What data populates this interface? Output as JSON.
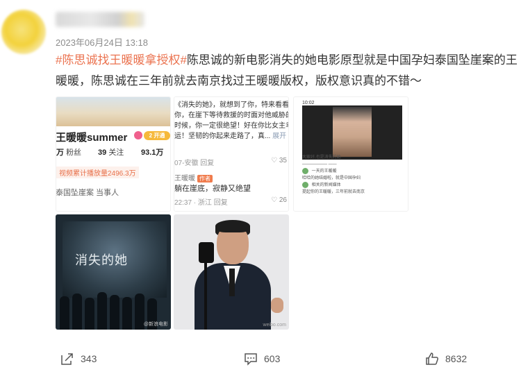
{
  "post": {
    "time": "2023年06月24日 13:18",
    "hashtag": "#陈思诚找王暖暖拿授权#",
    "body": "陈思诚的新电影消失的她电影原型就是中国孕妇泰国坠崖案的王暖暖，陈思诚在三年前就去南京找过王暖暖版权，版权意识真的不错～"
  },
  "images": {
    "tile1": {
      "name": "王暖暖summer",
      "badge": "2 开通",
      "stats": [
        {
          "value": "万",
          "label": "粉丝"
        },
        {
          "value": "39",
          "label": "关注"
        },
        {
          "value": "93.1万",
          "label": ""
        }
      ],
      "views": "视频累计播放量2496.3万",
      "tags": "泰国坠崖案  当事人"
    },
    "tile2": {
      "comment1": "《消失的她》，就想到了你，特来看看你，在崖下等待救援的时面对他威胁的时候，你一定很绝望！好在你比女主幸运！坚韧的你起来走路了，真...",
      "more": "展开",
      "meta1": "07-安徽    回复",
      "likes1": "35",
      "author": "王暖暖",
      "author_tag": "作者",
      "reply": "躺在崖底，寂静又绝望",
      "meta2": "22:37 · 浙江    回复",
      "likes2": "26"
    },
    "tile3": {
      "status_time": "10:02",
      "lines": [
        "大家好,也是消失的她",
        "——————  ——",
        "  一天的王暖暖",
        "  哈哈的她结婚啦，就是中国孕妇",
        "  相关的新闻媒体",
        "  提起你的王暖暖，三年前就去南京"
      ]
    },
    "tile4": {
      "title": "消失的她",
      "watermark": "@新浪电影"
    },
    "tile5": {
      "watermark": "weibo.com"
    }
  },
  "actions": {
    "share_count": "343",
    "comment_count": "603",
    "like_count": "8632"
  },
  "colors": {
    "hashtag": "#eb7350",
    "text": "#333333",
    "meta": "#8c8c8c"
  }
}
